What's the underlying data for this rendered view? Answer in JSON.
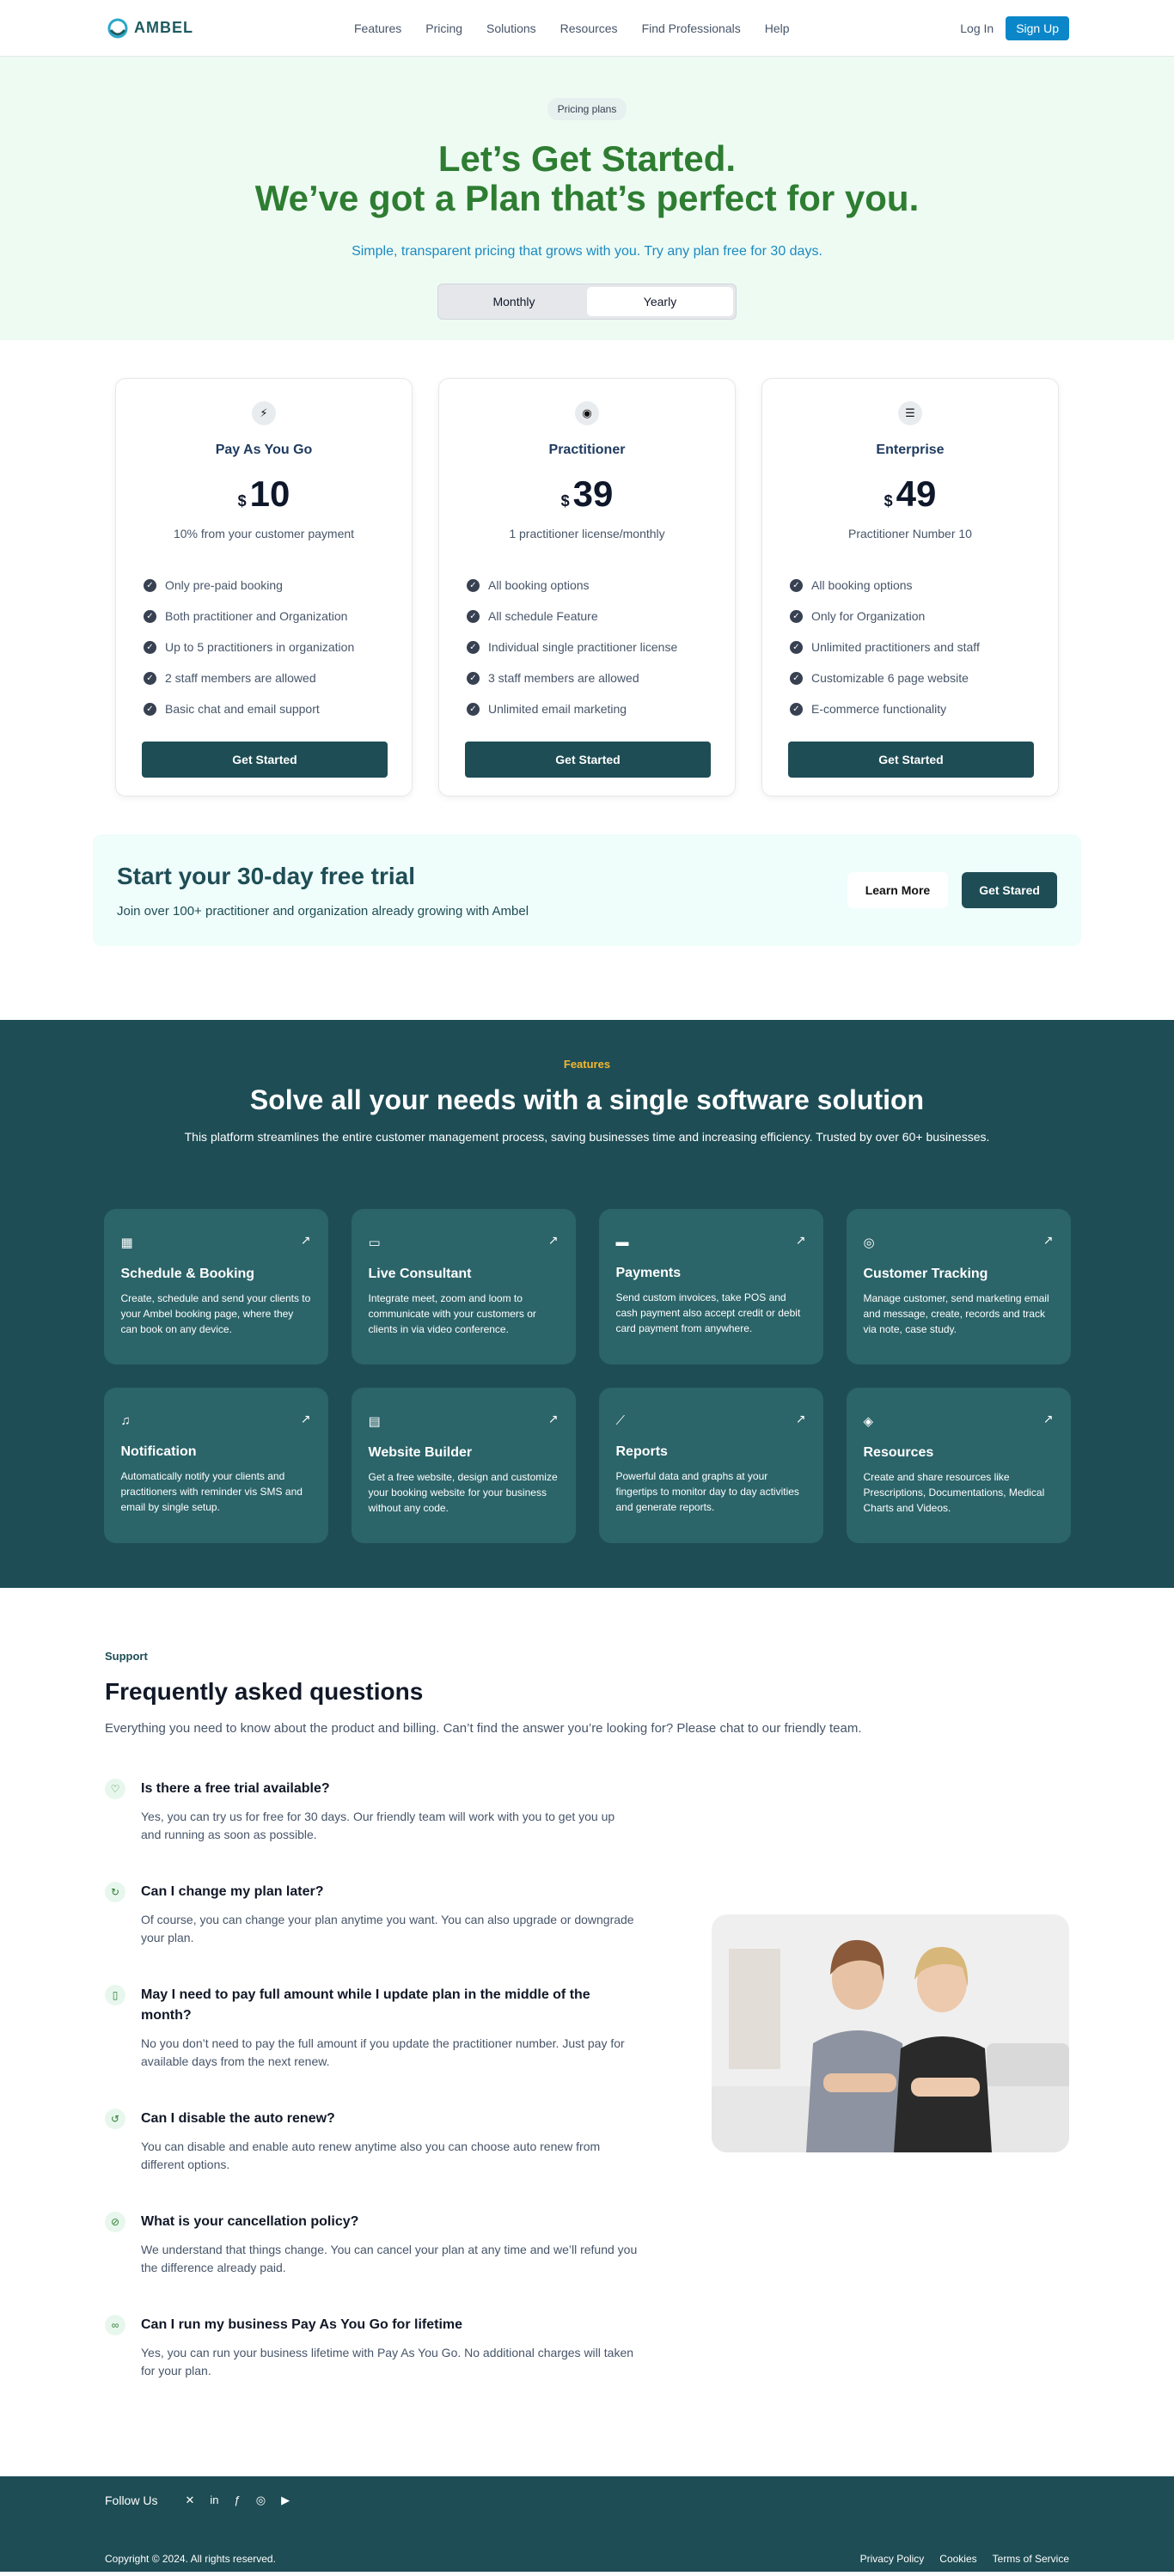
{
  "nav": {
    "brand": "AMBEL",
    "links": [
      "Features",
      "Pricing",
      "Solutions",
      "Resources",
      "Find Professionals",
      "Help"
    ],
    "login": "Log In",
    "signup": "Sign Up"
  },
  "hero": {
    "pill": "Pricing plans",
    "title_line1": "Let’s Get Started.",
    "title_line2": "We’ve got a Plan that’s perfect for you.",
    "subtitle": "Simple, transparent pricing that grows with you. Try any plan free for 30 days.",
    "toggle": [
      "Monthly",
      "Yearly"
    ]
  },
  "plans": [
    {
      "icon": "bolt-icon",
      "glyph": "⚡",
      "name": "Pay As You Go",
      "currency": "$",
      "price": "10",
      "sub": "10% from your customer payment",
      "features": [
        "Only pre-paid booking",
        "Both practitioner and Organization",
        "Up to 5 practitioners in organization",
        "2 staff members are allowed",
        "Basic chat and email support"
      ],
      "cta": "Get Started"
    },
    {
      "icon": "layers-icon",
      "glyph": "◉",
      "name": "Practitioner",
      "currency": "$",
      "price": "39",
      "sub": "1 practitioner license/monthly",
      "features": [
        "All booking options",
        "All schedule Feature",
        "Individual single practitioner license",
        "3 staff members are allowed",
        "Unlimited email marketing"
      ],
      "cta": "Get Started"
    },
    {
      "icon": "stack-icon",
      "glyph": "☰",
      "name": "Enterprise",
      "currency": "$",
      "price": "49",
      "sub": "Practitioner Number 10",
      "features": [
        "All booking options",
        "Only for Organization",
        "Unlimited practitioners and staff",
        "Customizable 6 page website",
        "E-commerce functionality"
      ],
      "cta": "Get Started"
    }
  ],
  "trial": {
    "title": "Start your 30-day free trial",
    "text": "Join over 100+ practitioner and organization already growing with Ambel",
    "learn": "Learn More",
    "start": "Get Stared"
  },
  "features": {
    "tag": "Features",
    "title": "Solve all your needs with a single software solution",
    "lead": "This platform streamlines the entire customer management process, saving businesses time and increasing efficiency. Trusted by over 60+ businesses.",
    "cards": [
      {
        "icon": "calendar-icon",
        "glyph": "▦",
        "title": "Schedule & Booking",
        "text": "Create, schedule and send your clients to your Ambel booking page, where they can book on any device."
      },
      {
        "icon": "video-icon",
        "glyph": "▭",
        "title": "Live Consultant",
        "text": "Integrate meet, zoom and loom to communicate with your customers or clients in via video conference."
      },
      {
        "icon": "card-icon",
        "glyph": "▬",
        "title": "Payments",
        "text": "Send custom invoices, take POS and cash payment also accept credit or debit card payment from anywhere."
      },
      {
        "icon": "fingerprint-icon",
        "glyph": "◎",
        "title": "Customer Tracking",
        "text": "Manage customer, send marketing email and message, create, records and track via note, case study."
      },
      {
        "icon": "bell-icon",
        "glyph": "♫",
        "title": "Notification",
        "text": "Automatically notify your clients and practitioners with reminder vis SMS and email by single setup."
      },
      {
        "icon": "browser-icon",
        "glyph": "▤",
        "title": "Website Builder",
        "text": "Get a free website, design and customize your booking website for your business without any code."
      },
      {
        "icon": "chart-icon",
        "glyph": "⟋",
        "title": "Reports",
        "text": "Powerful data and graphs at your fingertips to monitor day to day activities and generate reports."
      },
      {
        "icon": "layers-icon",
        "glyph": "◈",
        "title": "Resources",
        "text": "Create and share resources like Prescriptions, Documentations, Medical Charts and Videos."
      }
    ]
  },
  "faq": {
    "tag": "Support",
    "title": "Frequently asked questions",
    "intro": "Everything you need to know about the product and billing. Can’t find the answer you’re looking for? Please chat to our friendly team.",
    "items": [
      {
        "icon": "heart-icon",
        "glyph": "♡",
        "q": "Is there a free trial available?",
        "a": "Yes, you can try us for free for 30 days. Our friendly team will work with you to get you up and running as soon as possible."
      },
      {
        "icon": "refresh-icon",
        "glyph": "↻",
        "q": "Can I change my plan later?",
        "a": "Of course, you can change your plan anytime you want. You can also upgrade or downgrade your plan."
      },
      {
        "icon": "document-icon",
        "glyph": "▯",
        "q": "May I need to pay full amount while I update plan in the middle of the month?",
        "a": "No you don’t need to pay the full amount if you update the practitioner number. Just pay for available days from the next renew."
      },
      {
        "icon": "renew-icon",
        "glyph": "↺",
        "q": "Can I disable the auto renew?",
        "a": "You can disable and enable auto renew anytime also you can choose auto renew from different options."
      },
      {
        "icon": "cancel-icon",
        "glyph": "⊘",
        "q": "What is your cancellation policy?",
        "a": "We understand that things change. You can cancel your plan at any time and we’ll refund you the difference already paid."
      },
      {
        "icon": "infinity-icon",
        "glyph": "∞",
        "q": "Can I run my business Pay As You Go for lifetime",
        "a": "Yes, you can run your business lifetime with Pay As You Go. No additional charges will taken for your plan."
      }
    ]
  },
  "footer": {
    "follow": "Follow Us",
    "social": [
      "twitter-icon",
      "linkedin-icon",
      "facebook-icon",
      "instagram-icon",
      "youtube-icon"
    ],
    "copyright": "Copyright © 2024. All rights reserved.",
    "links": [
      "Privacy Policy",
      "Cookies",
      "Terms of Service"
    ]
  }
}
